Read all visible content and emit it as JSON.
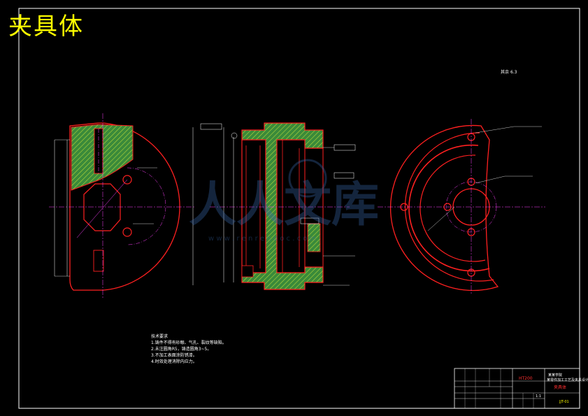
{
  "banner": {
    "title": "夹具体"
  },
  "roughness": {
    "label": "其余",
    "value": "6.3"
  },
  "notes": {
    "heading": "技术要求",
    "lines": [
      "1.铸件不得有砂眼、气孔、裂纹等缺陷。",
      "2.未注圆角R5，铸造圆角3~5。",
      "3.不加工表面涂防锈漆。",
      "4.时效处理消除内应力。"
    ]
  },
  "title_block": {
    "part_name": "夹具体",
    "school": "某某学院",
    "project": "某零件加工工艺及夹具设计",
    "material": "HT200",
    "scale": "1:1",
    "drawing_no": "JJT-01"
  },
  "watermark": {
    "brand": "人人文库",
    "url": "w w w . r e n r e n d o c . c o m"
  },
  "colors": {
    "outline": "#ff2020",
    "hatch": "#40a040",
    "centerline": "#ff40ff",
    "dimension": "#ffffff",
    "banner": "#ffff00"
  }
}
